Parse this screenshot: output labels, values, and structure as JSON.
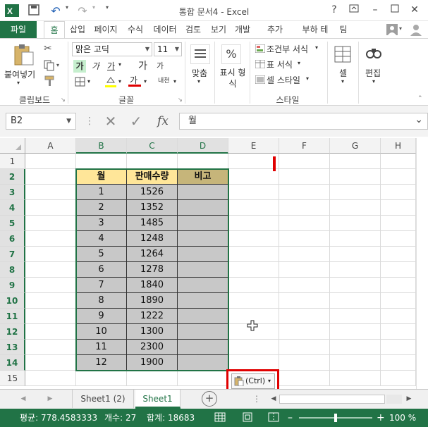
{
  "app": {
    "title": "통합 문서4 - Excel",
    "help": "?",
    "undo": "↶",
    "redo": "↷"
  },
  "tabs": [
    "파일",
    "홈",
    "삽입",
    "페이지",
    "수식",
    "데이터",
    "검토",
    "보기",
    "개발",
    "추가",
    "부하 테",
    "팀"
  ],
  "ribbon": {
    "clipboard": {
      "paste": "붙여넣기",
      "label": "클립보드"
    },
    "font": {
      "name": "맑은 고딕",
      "size": "11",
      "label": "글꼴",
      "bold": "가",
      "italic": "가",
      "underline": "가",
      "grow": "가",
      "shrink": "가",
      "fontcolor": "가",
      "phonetic": "내천"
    },
    "alignment": {
      "label": "맞춤"
    },
    "number": {
      "label": "표시 형\n식",
      "pct": "%"
    },
    "styles": {
      "conditional": "조건부 서식",
      "table": "표 서식",
      "cell": "셀 스타일",
      "label": "스타일"
    },
    "cells": {
      "label": "셀"
    },
    "editing": {
      "label": "편집"
    }
  },
  "formula_bar": {
    "name_box": "B2",
    "fx": "fx",
    "value": "월"
  },
  "columns": [
    "A",
    "B",
    "C",
    "D",
    "E",
    "F",
    "G",
    "H"
  ],
  "rows": [
    "1",
    "2",
    "3",
    "4",
    "5",
    "6",
    "7",
    "8",
    "9",
    "10",
    "11",
    "12",
    "13",
    "14",
    "15"
  ],
  "table": {
    "headers": [
      "월",
      "판매수량",
      "비고"
    ],
    "rows": [
      [
        "1",
        "1526",
        ""
      ],
      [
        "2",
        "1352",
        ""
      ],
      [
        "3",
        "1485",
        ""
      ],
      [
        "4",
        "1248",
        ""
      ],
      [
        "5",
        "1264",
        ""
      ],
      [
        "6",
        "1278",
        ""
      ],
      [
        "7",
        "1840",
        ""
      ],
      [
        "8",
        "1890",
        ""
      ],
      [
        "9",
        "1222",
        ""
      ],
      [
        "10",
        "1300",
        ""
      ],
      [
        "11",
        "2300",
        ""
      ],
      [
        "12",
        "1900",
        ""
      ]
    ]
  },
  "paste_options": {
    "label": "(Ctrl)"
  },
  "sheets": [
    "Sheet1 (2)",
    "Sheet1"
  ],
  "active_sheet": "Sheet1",
  "status": {
    "average": "평균: 778.4583333",
    "count": "개수: 27",
    "sum": "합계: 18683",
    "zoom": "100 %"
  },
  "colors": {
    "excel_green": "#217346",
    "header_fill": "#ffe699",
    "header_fill_2": "#c6b57a",
    "selection_fill": "#c8c8c8",
    "highlight_red": "#e00000"
  }
}
